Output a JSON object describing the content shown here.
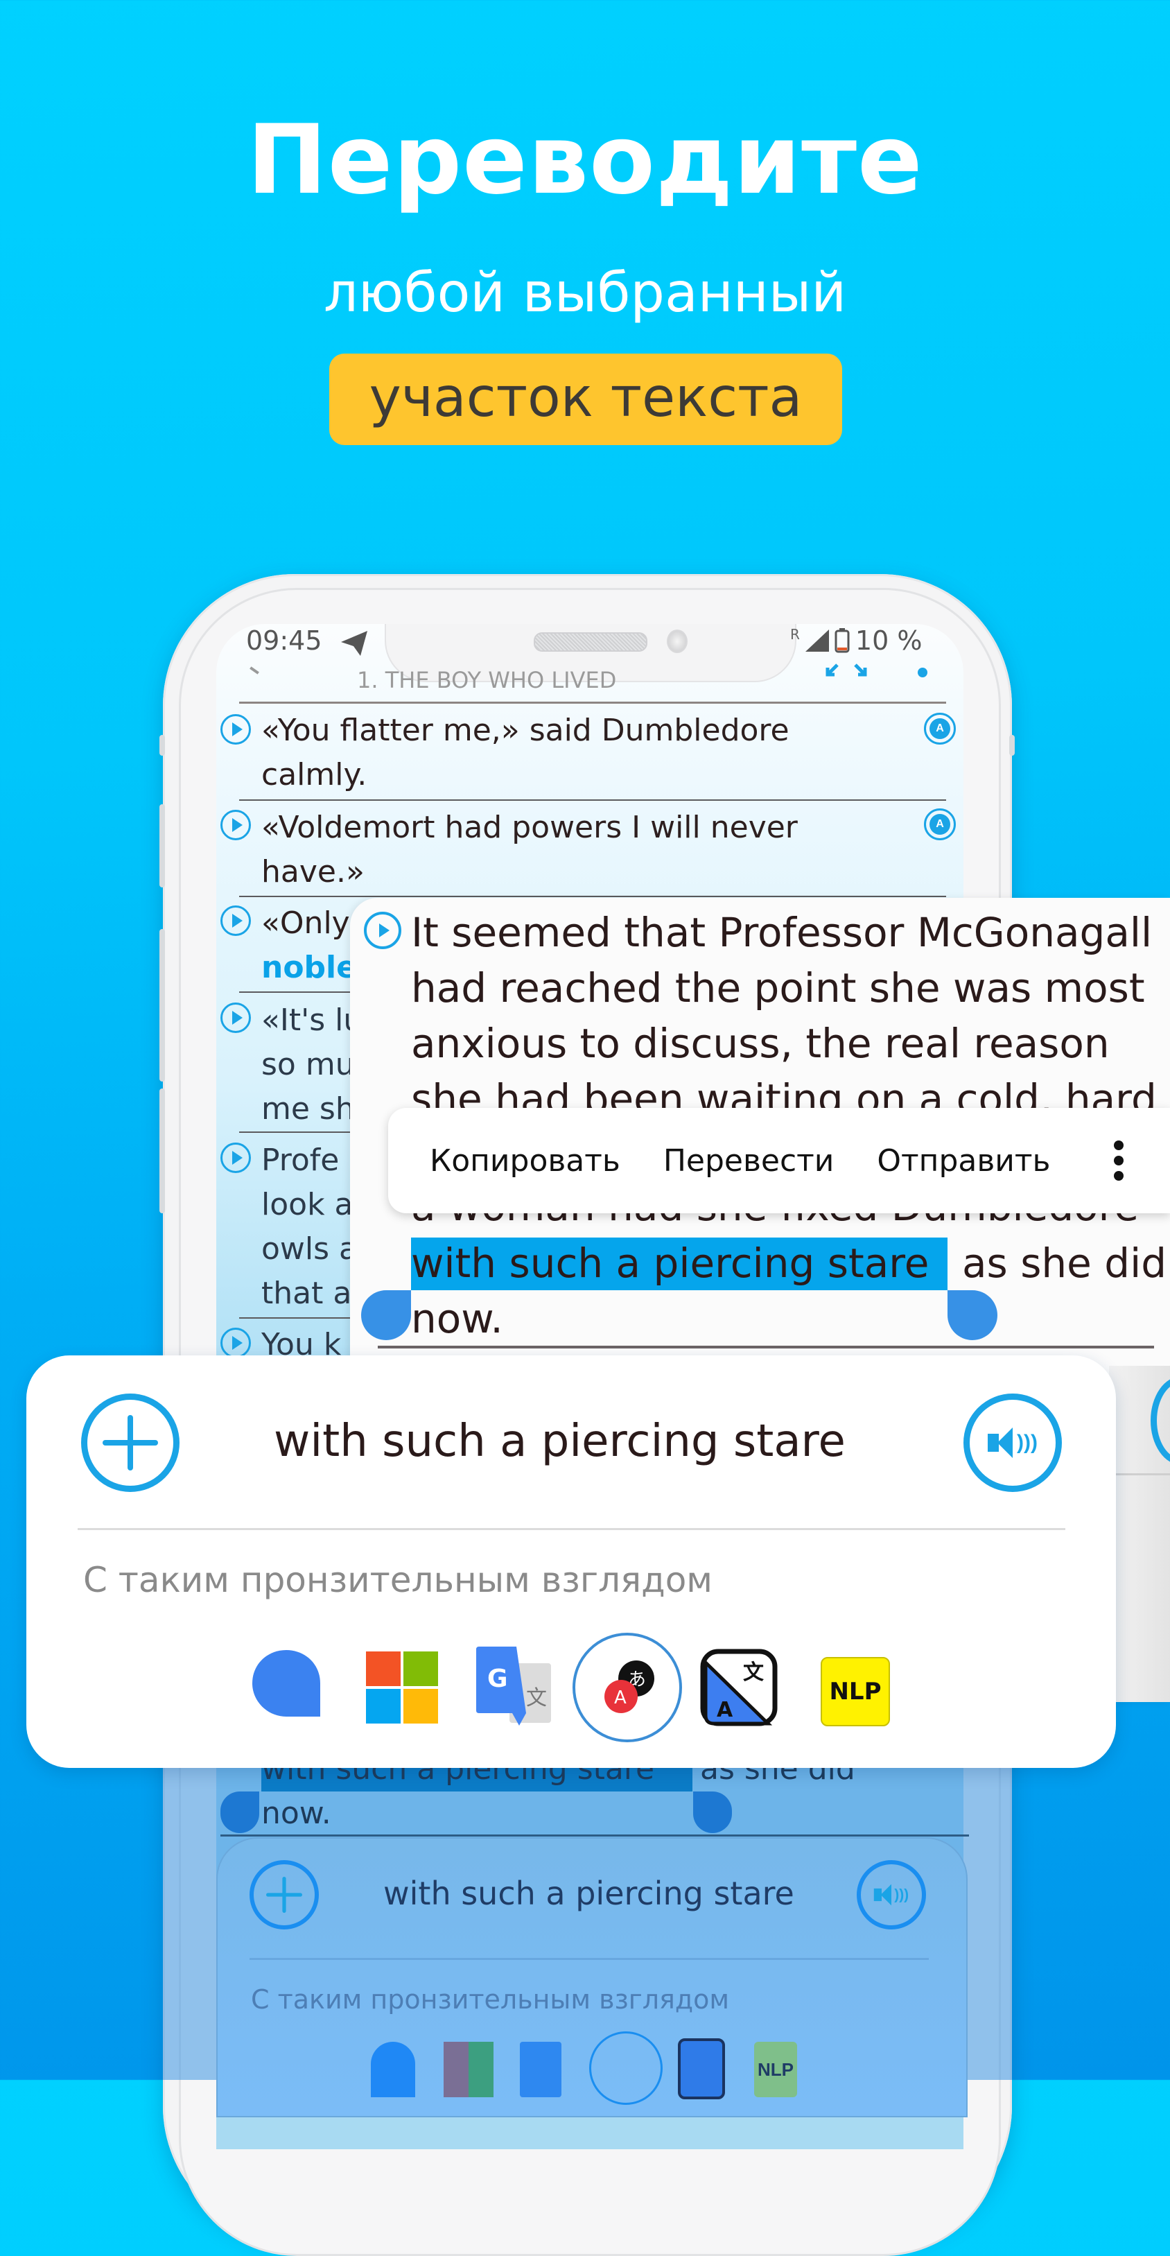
{
  "promo": {
    "headline": "Переводите",
    "subline": "любой выбранный",
    "highlight_pill": "участок текста",
    "colors": {
      "background_top": "#00d1ff",
      "background_bottom": "#0094ea",
      "pill": "#fec52e",
      "accent": "#1aa4e6",
      "selection": "#05a5ec"
    }
  },
  "status_bar": {
    "time": "09:45",
    "signal_label": "R",
    "battery": "10 %"
  },
  "reader": {
    "chapter_title": "1. THE BOY WHO LIVED",
    "rows": [
      {
        "lines": [
          "«You flatter me,» said Dumbledore",
          "calmly."
        ]
      },
      {
        "lines": [
          "«Voldemort had powers I will never",
          "have.»"
        ]
      },
      {
        "lines": [
          "«Only",
          "noble"
        ]
      },
      {
        "lines": [
          "«It's lu",
          "so mu",
          "me sh"
        ]
      },
      {
        "lines": [
          "Profe",
          "look a",
          "owls a",
          "that a"
        ]
      },
      {
        "lines": [
          "You k"
        ]
      }
    ]
  },
  "book_popup": {
    "lines": [
      "It seemed that Professor McGonagall",
      "had reached the point she was most",
      "anxious to discuss, the real reason",
      "she had been waiting on a cold, hard",
      "a woman had she fixed Dumbledore",
      "as she did",
      "now."
    ],
    "selected_text": "with such a piercing stare"
  },
  "context_menu": {
    "items": [
      "Копировать",
      "Перевести",
      "Отправить"
    ],
    "more_icon": "kebab-vertical-icon"
  },
  "translation_card": {
    "phrase": "with such a piercing stare",
    "translation": "С таким пронзительным взглядом",
    "add_icon": "plus-circle-icon",
    "speak_icon": "speaker-icon",
    "engines": [
      {
        "name": "yandex-icon"
      },
      {
        "name": "microsoft-icon"
      },
      {
        "name": "google-translate-icon"
      },
      {
        "name": "reverso-icon",
        "selected": true
      },
      {
        "name": "deepl-icon"
      },
      {
        "name": "nlp-icon",
        "label": "NLP"
      }
    ]
  }
}
